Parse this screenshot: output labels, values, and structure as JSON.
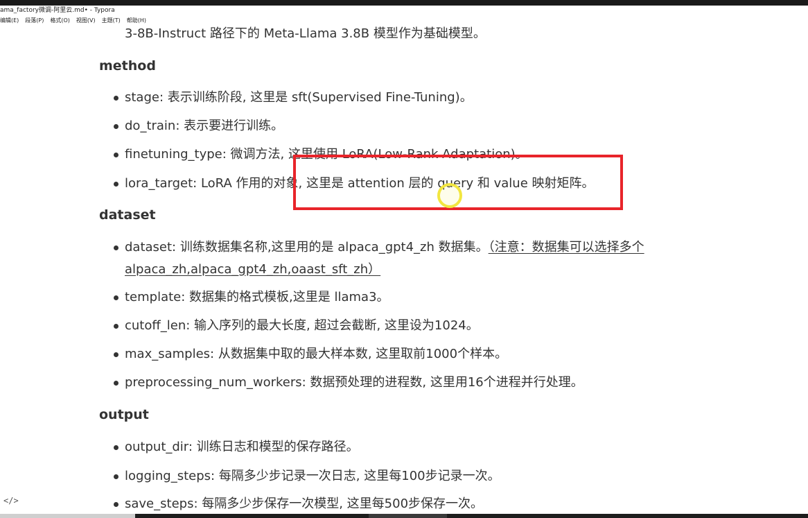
{
  "window": {
    "title": "ama_factory微调-阿里云.md• - Typora"
  },
  "menu": [
    "编辑(E)",
    "段落(P)",
    "格式(O)",
    "视图(V)",
    "主题(T)",
    "帮助(H)"
  ],
  "document": {
    "first_line": "3-8B-Instruct 路径下的 Meta-Llama 3.8B 模型作为基础模型。",
    "sections": [
      {
        "heading": "method",
        "items": [
          "stage: 表示训练阶段, 这里是 sft(Supervised Fine-Tuning)。",
          "do_train: 表示要进行训练。",
          "finetuning_type: 微调方法, 这里使用 LoRA(Low-Rank Adaptation)。",
          "lora_target: LoRA 作用的对象, 这里是 attention 层的 query 和 value 映射矩阵。"
        ]
      },
      {
        "heading": "dataset",
        "items": [
          "dataset: 训练数据集名称,这里用的是 alpaca_gpt4_zh 数据集。",
          "template: 数据集的格式模板,这里是 llama3。",
          "cutoff_len: 输入序列的最大长度, 超过会截断, 这里设为1024。",
          "max_samples: 从数据集中取的最大样本数, 这里取前1000个样本。",
          "preprocessing_num_workers: 数据预处理的进程数, 这里用16个进程并行处理。"
        ],
        "note_part1": "（注意：数据集可以选择多个",
        "note_part2": "alpaca_zh,alpaca_gpt4_zh,oaast_sft_zh）"
      },
      {
        "heading": "output",
        "items": [
          "output_dir: 训练日志和模型的保存路径。",
          "logging_steps: 每隔多少步记录一次日志, 这里每100步记录一次。",
          "save_steps: 每隔多少步保存一次模型, 这里每500步保存一次。"
        ]
      }
    ]
  },
  "source_toggle": "</>",
  "colors": {
    "highlight_box": "#e8242a",
    "cursor_ring": "#f2e640",
    "text": "#333333"
  }
}
